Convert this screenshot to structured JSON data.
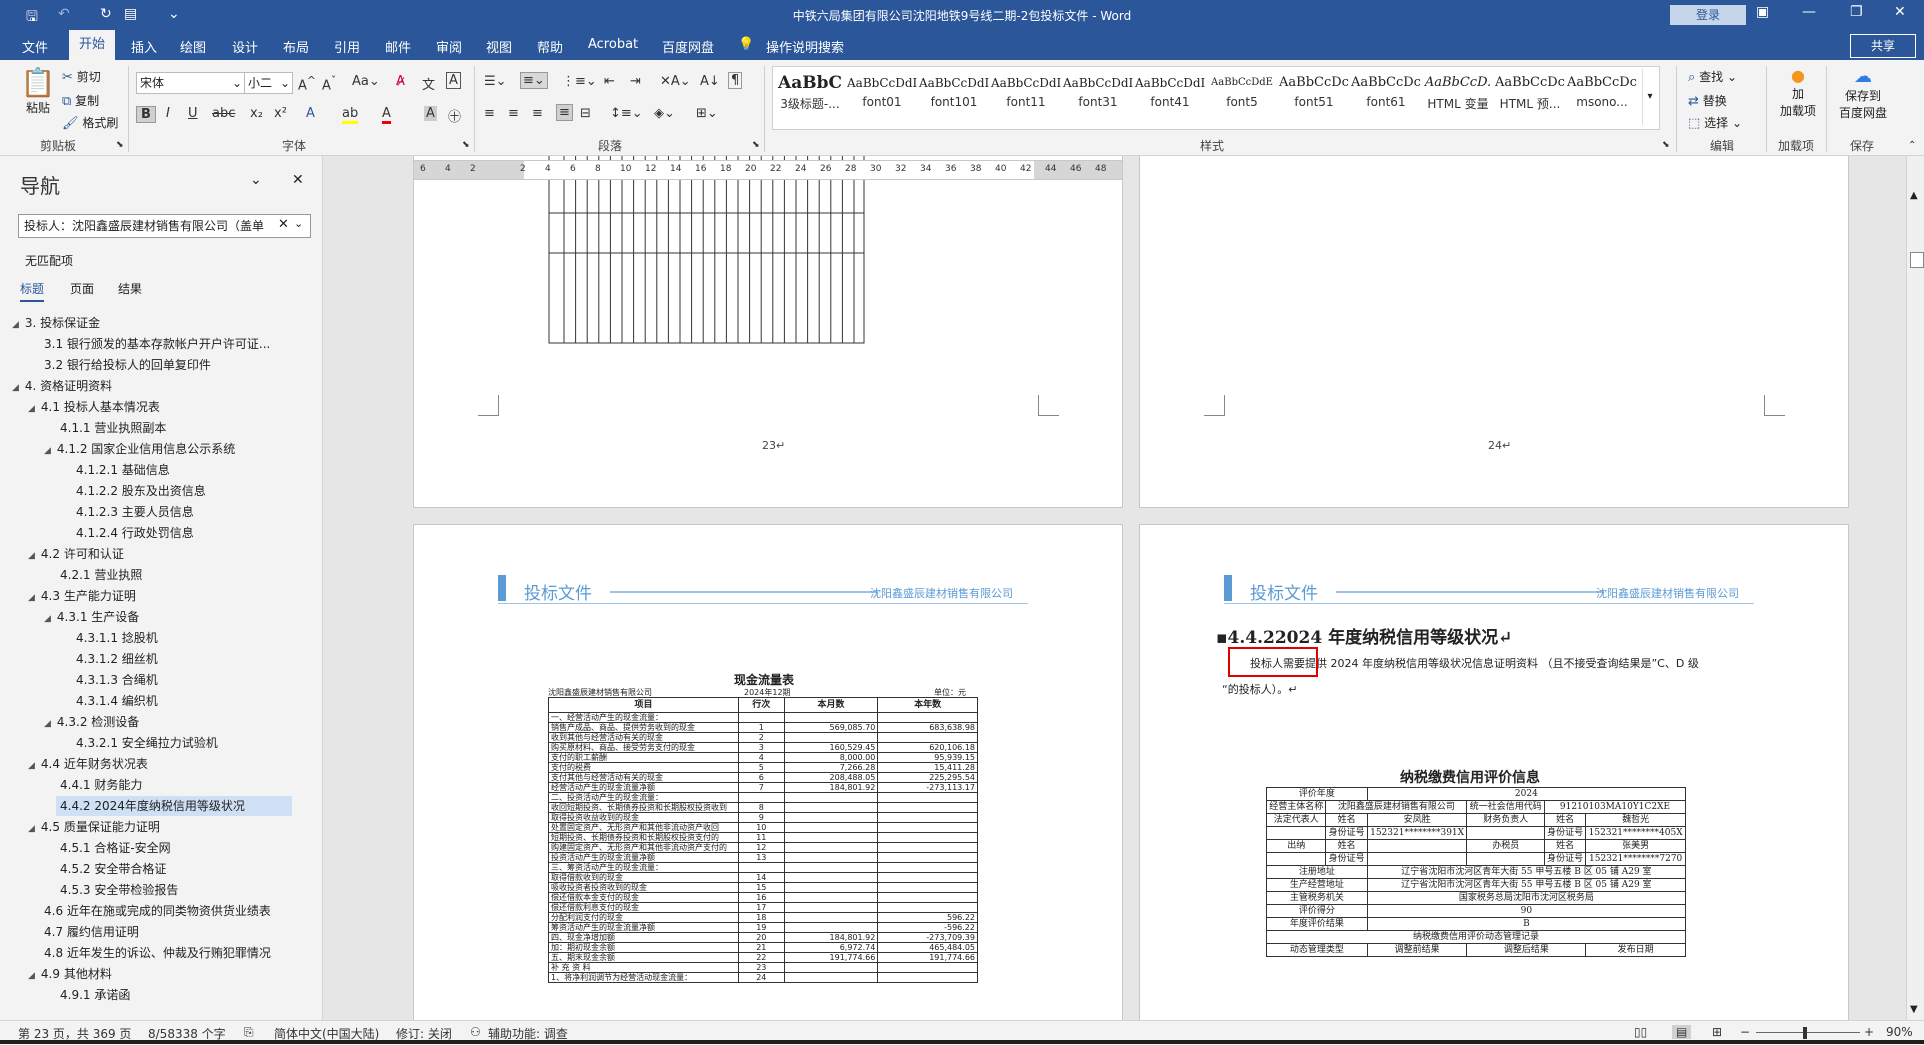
{
  "window": {
    "title": "中铁六局集团有限公司沈阳地铁9号线二期-2包投标文件  -  Word",
    "login": "登录"
  },
  "tabs": [
    "文件",
    "开始",
    "插入",
    "绘图",
    "设计",
    "布局",
    "引用",
    "邮件",
    "审阅",
    "视图",
    "帮助",
    "Acrobat",
    "百度网盘"
  ],
  "tell_me": "操作说明搜索",
  "share": "共享",
  "ribbon": {
    "clipboard": {
      "paste": "粘贴",
      "cut": "剪切",
      "copy": "复制",
      "format_painter": "格式刷",
      "label": "剪贴板"
    },
    "font": {
      "name": "宋体",
      "size": "小二",
      "label": "字体"
    },
    "paragraph": {
      "label": "段落"
    },
    "styles": {
      "label": "样式",
      "items": [
        {
          "sample": "AaBbC",
          "name": "3级标题-..."
        },
        {
          "sample": "AaBbCcDdI",
          "name": "font01"
        },
        {
          "sample": "AaBbCcDdI",
          "name": "font101"
        },
        {
          "sample": "AaBbCcDdI",
          "name": "font11"
        },
        {
          "sample": "AaBbCcDdI",
          "name": "font31"
        },
        {
          "sample": "AaBbCcDdI",
          "name": "font41"
        },
        {
          "sample": "AaBbCcDdE",
          "name": "font5"
        },
        {
          "sample": "AaBbCcDc",
          "name": "font51"
        },
        {
          "sample": "AaBbCcDc",
          "name": "font61"
        },
        {
          "sample": "AaBbCcD.",
          "name": "HTML 变量"
        },
        {
          "sample": "AaBbCcDc",
          "name": "HTML 预..."
        },
        {
          "sample": "AaBbCcDc",
          "name": "msono..."
        }
      ]
    },
    "editing": {
      "find": "查找",
      "replace": "替换",
      "select": "选择",
      "label": "编辑"
    },
    "addins": {
      "add": "加载项",
      "label": "加载项",
      "add_short": "加"
    },
    "save": {
      "btn_line1": "保存到",
      "btn_line2": "百度网盘",
      "label": "保存"
    }
  },
  "nav": {
    "title": "导航",
    "search_value": "投标人：沈阳鑫盛辰建材销售有限公司（盖单",
    "no_match": "无匹配项",
    "tabs": [
      "标题",
      "页面",
      "结果"
    ],
    "items": [
      {
        "level": 1,
        "text": "3. 投标保证金",
        "tri": "◢"
      },
      {
        "level": 2,
        "text": "3.1 银行颁发的基本存款帐户开户许可证...",
        "tri": ""
      },
      {
        "level": 2,
        "text": "3.2 银行给投标人的回单复印件",
        "tri": ""
      },
      {
        "level": 1,
        "text": "4. 资格证明资料",
        "tri": "◢"
      },
      {
        "level": 2,
        "text": "4.1 投标人基本情况表",
        "tri": "◢"
      },
      {
        "level": 3,
        "text": "4.1.1 营业执照副本",
        "tri": ""
      },
      {
        "level": 3,
        "text": "4.1.2 国家企业信用信息公示系统",
        "tri": "◢"
      },
      {
        "level": 4,
        "text": "4.1.2.1 基础信息",
        "tri": ""
      },
      {
        "level": 4,
        "text": "4.1.2.2 股东及出资信息",
        "tri": ""
      },
      {
        "level": 4,
        "text": "4.1.2.3 主要人员信息",
        "tri": ""
      },
      {
        "level": 4,
        "text": "4.1.2.4 行政处罚信息",
        "tri": ""
      },
      {
        "level": 2,
        "text": "4.2 许可和认证",
        "tri": "◢"
      },
      {
        "level": 3,
        "text": "4.2.1 营业执照",
        "tri": ""
      },
      {
        "level": 2,
        "text": "4.3 生产能力证明",
        "tri": "◢"
      },
      {
        "level": 3,
        "text": "4.3.1 生产设备",
        "tri": "◢"
      },
      {
        "level": 4,
        "text": "4.3.1.1 捻股机",
        "tri": ""
      },
      {
        "level": 4,
        "text": "4.3.1.2 细丝机",
        "tri": ""
      },
      {
        "level": 4,
        "text": "4.3.1.3 合绳机",
        "tri": ""
      },
      {
        "level": 4,
        "text": "4.3.1.4 编织机",
        "tri": ""
      },
      {
        "level": 3,
        "text": "4.3.2 检测设备",
        "tri": "◢"
      },
      {
        "level": 4,
        "text": "4.3.2.1 安全绳拉力试验机",
        "tri": ""
      },
      {
        "level": 2,
        "text": "4.4 近年财务状况表",
        "tri": "◢"
      },
      {
        "level": 3,
        "text": "4.4.1 财务能力",
        "tri": ""
      },
      {
        "level": 3,
        "text": "4.4.2 2024年度纳税信用等级状况",
        "tri": "",
        "selected": true
      },
      {
        "level": 2,
        "text": "4.5 质量保证能力证明",
        "tri": "◢"
      },
      {
        "level": 3,
        "text": "4.5.1 合格证-安全网",
        "tri": ""
      },
      {
        "level": 3,
        "text": "4.5.2 安全带合格证",
        "tri": ""
      },
      {
        "level": 3,
        "text": "4.5.3 安全带检验报告",
        "tri": ""
      },
      {
        "level": 2,
        "text": "4.6 近年在施或完成的同类物资供货业绩表",
        "tri": ""
      },
      {
        "level": 2,
        "text": "4.7 履约信用证明",
        "tri": ""
      },
      {
        "level": 2,
        "text": "4.8 近年发生的诉讼、仲裁及行贿犯罪情况",
        "tri": ""
      },
      {
        "level": 2,
        "text": "4.9 其他材料",
        "tri": "◢"
      },
      {
        "level": 3,
        "text": "4.9.1 承诺函",
        "tri": ""
      }
    ]
  },
  "ruler": {
    "ticks": [
      "6",
      "4",
      "2",
      "",
      "2",
      "4",
      "6",
      "8",
      "10",
      "12",
      "14",
      "16",
      "18",
      "20",
      "22",
      "24",
      "26",
      "28",
      "30",
      "32",
      "34",
      "36",
      "38",
      "40",
      "42",
      "44",
      "46",
      "48"
    ]
  },
  "pages": {
    "p23_no": "23↵",
    "p24_no": "24↵",
    "header_title": "投标文件",
    "header_company": "沈阳鑫盛辰建材销售有限公司",
    "cashflow": {
      "title": "现金流量表",
      "company": "沈阳鑫盛辰建材销售有限公司",
      "period": "2024年12期",
      "unit": "单位：元",
      "headers": [
        "项目",
        "行次",
        "本月数",
        "本年数"
      ],
      "rows": [
        [
          "一、经营活动产生的现金流量：",
          "",
          "",
          ""
        ],
        [
          "销售产成品、商品、提供劳务收到的现金",
          "1",
          "569,085.70",
          "683,638.98"
        ],
        [
          "收到其他与经营活动有关的现金",
          "2",
          "",
          ""
        ],
        [
          "购买原材料、商品、接受劳务支付的现金",
          "3",
          "160,529.45",
          "620,106.18"
        ],
        [
          "支付的职工薪酬",
          "4",
          "8,000.00",
          "95,939.15"
        ],
        [
          "支付的税费",
          "5",
          "7,266.28",
          "15,411.28"
        ],
        [
          "支付其他与经营活动有关的现金",
          "6",
          "208,488.05",
          "225,295.54"
        ],
        [
          "经营活动产生的现金流量净额",
          "7",
          "184,801.92",
          "-273,113.17"
        ],
        [
          "二、投资活动产生的现金流量：",
          "",
          "",
          ""
        ],
        [
          "收回短期投资、长期债券投资和长期股权投资收到",
          "8",
          "",
          ""
        ],
        [
          "取得投资收益收到的现金",
          "9",
          "",
          ""
        ],
        [
          "处置固定资产、无形资产和其他非流动资产收回",
          "10",
          "",
          ""
        ],
        [
          "短期投资、长期债券投资和长期股权投资支付的",
          "11",
          "",
          ""
        ],
        [
          "购建固定资产、无形资产和其他非流动资产支付的",
          "12",
          "",
          ""
        ],
        [
          "投资活动产生的现金流量净额",
          "13",
          "",
          ""
        ],
        [
          "三、筹资活动产生的现金流量：",
          "",
          "",
          ""
        ],
        [
          "取得借款收到的现金",
          "14",
          "",
          ""
        ],
        [
          "吸收投资者投资收到的现金",
          "15",
          "",
          ""
        ],
        [
          "偿还借款本金支付的现金",
          "16",
          "",
          ""
        ],
        [
          "偿还借款利息支付的现金",
          "17",
          "",
          ""
        ],
        [
          "分配利润支付的现金",
          "18",
          "",
          "596.22"
        ],
        [
          "筹资活动产生的现金流量净额",
          "19",
          "",
          "-596.22"
        ],
        [
          "四、现金净增加额",
          "20",
          "184,801.92",
          "-273,709.39"
        ],
        [
          "加：期初现金余额",
          "21",
          "6,972.74",
          "465,484.05"
        ],
        [
          "五、期末现金余额",
          "22",
          "191,774.66",
          "191,774.66"
        ],
        [
          "补 充 资 料",
          "23",
          "",
          ""
        ],
        [
          "1、将净利润调节为经营活动现金流量：",
          "24",
          "",
          ""
        ]
      ]
    },
    "section_heading": "▪4.4.22024 年度纳税信用等级状况↵",
    "para1": "投标人需要提供 2024 年度纳税信用等级状况信息证明资料 （且不接受查询结果是”C、D 级",
    "para2": "“的投标人）。↵",
    "tax": {
      "title": "纳税缴费信用评价信息",
      "rows": [
        [
          "评价年度",
          "2024"
        ],
        [
          "经营主体名称",
          "沈阳鑫盛辰建材销售有限公司",
          "统一社会信用代码",
          "91210103MA10Y1C2XE"
        ],
        [
          "法定代表人",
          "姓名",
          "安凤胜",
          "财务负责人",
          "姓名",
          "魏哲光"
        ],
        [
          "",
          "身份证号",
          "152321********391X",
          "",
          "身份证号",
          "152321********405X"
        ],
        [
          "出纳",
          "姓名",
          "",
          "办税员",
          "姓名",
          "张美男"
        ],
        [
          "",
          "身份证号",
          "",
          "",
          "身份证号",
          "152321********7270"
        ],
        [
          "注册地址",
          "辽宁省沈阳市沈河区青年大街 55 甲号五楼 B 区 05 铺 A29 室"
        ],
        [
          "生产经营地址",
          "辽宁省沈阳市沈河区青年大街 55 甲号五楼 B 区 05 铺 A29 室"
        ],
        [
          "主管税务机关",
          "国家税务总局沈阳市沈河区税务局"
        ],
        [
          "评价得分",
          "90"
        ],
        [
          "年度评价结果",
          "B"
        ],
        [
          "纳税缴费信用评价动态管理记录"
        ],
        [
          "动态管理类型",
          "调整前结果",
          "调整后结果",
          "发布日期"
        ]
      ]
    }
  },
  "status": {
    "page": "第 23 页，共 369 页",
    "words": "8/58338 个字",
    "lang": "简体中文(中国大陆)",
    "track": "修订: 关闭",
    "access": "辅助功能: 调查",
    "zoom": "90%"
  },
  "colors": {
    "brand": "#2b579a",
    "accent": "#5b9bd5",
    "highlight_box": "#e00000"
  }
}
